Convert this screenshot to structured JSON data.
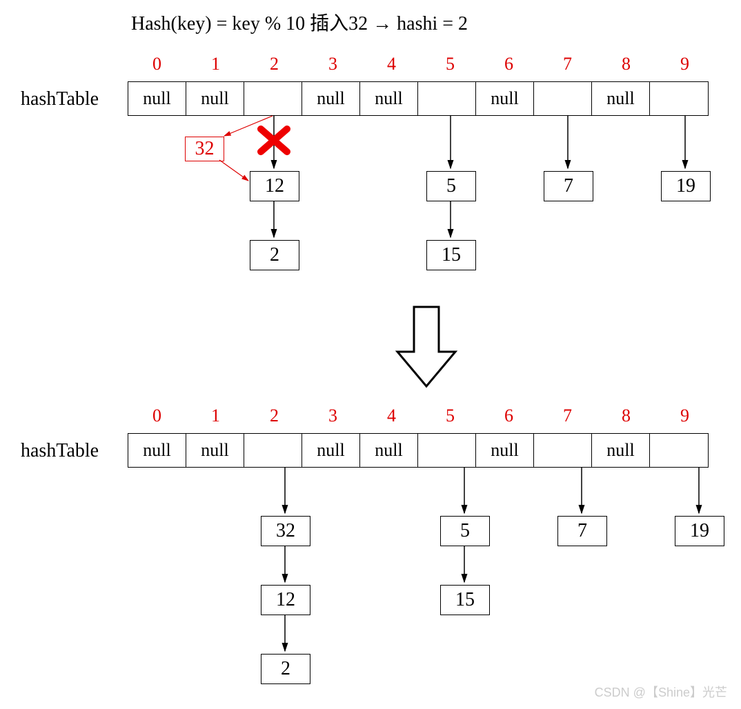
{
  "formula_full": "Hash(key) = key % 10    插入32 → hashi = 2",
  "label_hashtable": "hashTable",
  "indices": [
    "0",
    "1",
    "2",
    "3",
    "4",
    "5",
    "6",
    "7",
    "8",
    "9"
  ],
  "table1_cells": [
    "null",
    "null",
    "",
    "null",
    "null",
    "",
    "null",
    "",
    "null",
    ""
  ],
  "table2_cells": [
    "null",
    "null",
    "",
    "null",
    "null",
    "",
    "null",
    "",
    "null",
    ""
  ],
  "insert_value": "32",
  "t1": {
    "c2_n1": "12",
    "c2_n2": "2",
    "c5_n1": "5",
    "c5_n2": "15",
    "c7_n1": "7",
    "c9_n1": "19"
  },
  "t2": {
    "c2_n1": "32",
    "c2_n2": "12",
    "c2_n3": "2",
    "c5_n1": "5",
    "c5_n2": "15",
    "c7_n1": "7",
    "c9_n1": "19"
  },
  "watermark": "CSDN @【Shine】光芒"
}
